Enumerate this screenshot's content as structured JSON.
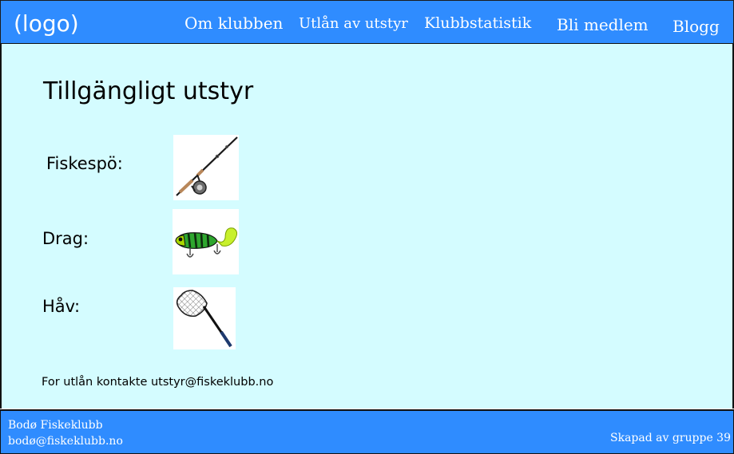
{
  "header": {
    "logo": "(logo)",
    "nav": [
      "Om klubben",
      "Utlån av utstyr",
      "Klubbstatistik",
      "Bli medlem",
      "Blogg"
    ]
  },
  "main": {
    "title": "Tillgängligt utstyr",
    "items": [
      {
        "label": "Fiskespö:",
        "icon": "fishing-rod-icon"
      },
      {
        "label": "Drag:",
        "icon": "fishing-lure-icon"
      },
      {
        "label": "Håv:",
        "icon": "landing-net-icon"
      }
    ],
    "contact": "For utlån kontakte utstyr@fiskeklubb.no"
  },
  "footer": {
    "club_name": "Bodø Fiskeklubb",
    "email": "bodø@fiskeklubb.no",
    "credit": "Skapad av gruppe 39"
  },
  "colors": {
    "header_bg": "#2f8cff",
    "main_bg": "#d4fcff",
    "footer_bg": "#2f8cff"
  }
}
